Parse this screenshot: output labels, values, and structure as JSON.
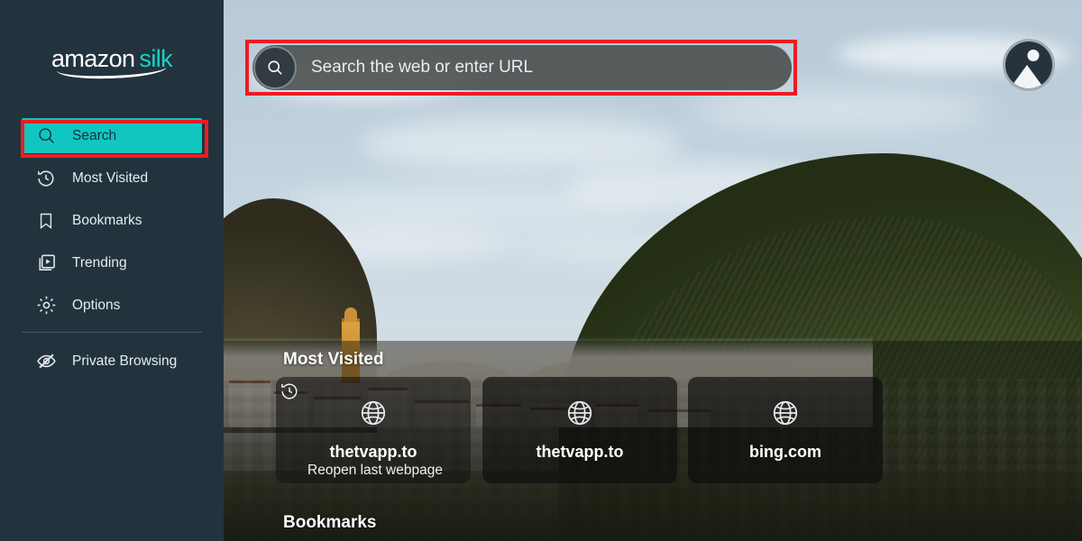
{
  "app": {
    "brand_primary": "amazon",
    "brand_secondary": "silk",
    "sidebar_bg": "#22333e",
    "accent_teal": "#11c6c0",
    "highlight_red": "#ee1b24"
  },
  "sidebar": {
    "items": [
      {
        "label": "Search",
        "icon": "search-icon",
        "active": true
      },
      {
        "label": "Most Visited",
        "icon": "history-clock-icon",
        "active": false
      },
      {
        "label": "Bookmarks",
        "icon": "bookmark-icon",
        "active": false
      },
      {
        "label": "Trending",
        "icon": "trending-play-icon",
        "active": false
      },
      {
        "label": "Options",
        "icon": "gear-icon",
        "active": false
      }
    ],
    "private": {
      "label": "Private Browsing",
      "icon": "eye-off-icon"
    }
  },
  "topbar": {
    "url_placeholder": "Search the web or enter URL",
    "search_icon": "search-icon",
    "avatar_icon": "user-avatar-icon"
  },
  "main": {
    "sections": [
      {
        "title": "Most Visited"
      },
      {
        "title": "Bookmarks"
      }
    ],
    "most_visited_cards": [
      {
        "label": "thetvapp.to",
        "icon": "globe-icon",
        "badge": "history-clock-icon",
        "caption": "Reopen last webpage"
      },
      {
        "label": "thetvapp.to",
        "icon": "globe-icon"
      },
      {
        "label": "bing.com",
        "icon": "globe-icon"
      }
    ]
  },
  "annotations": {
    "url_bar_highlight": "red-rectangle",
    "search_nav_highlight": "red-rectangle"
  }
}
